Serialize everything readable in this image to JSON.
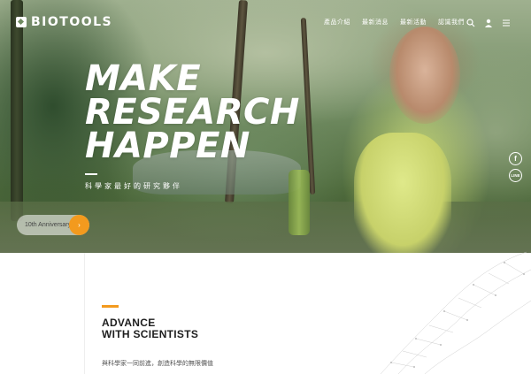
{
  "brand": {
    "name": "BIOTOOLS"
  },
  "nav": {
    "items": [
      "產品介紹",
      "最新消息",
      "最新活動",
      "認識我們"
    ]
  },
  "icons": {
    "search": "search-icon",
    "user": "user-icon",
    "menu": "menu-icon",
    "facebook": "facebook-icon",
    "line": "line-icon",
    "arrow": "arrow-right-icon"
  },
  "hero": {
    "headline": [
      "MAKE",
      "RESEARCH",
      "HAPPEN"
    ],
    "tagline": "科學家最好的研究夥伴",
    "social": {
      "facebook": "f",
      "line": "LINE"
    },
    "anniversary": {
      "label": "10th Anniversary",
      "button": "›"
    }
  },
  "section": {
    "title": [
      "ADVANCE",
      "WITH SCIENTISTS"
    ],
    "subtitle": "與科學家一同前進，創造科學的無限價值"
  },
  "colors": {
    "accent": "#f39a1e",
    "text": "#1e1e1e"
  }
}
